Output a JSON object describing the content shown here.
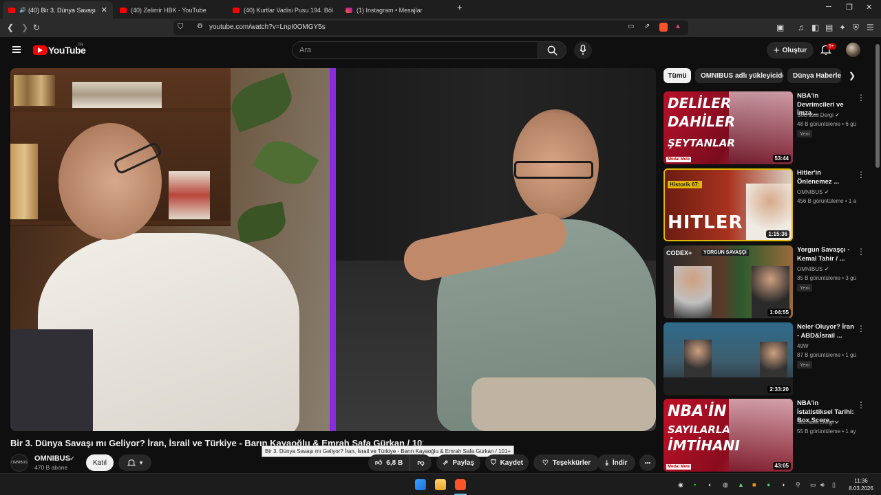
{
  "browser": {
    "tabs": [
      {
        "title": "(40) Bir 3. Dünya Savaşı mı Ge",
        "active": true,
        "icon": "youtube-icon"
      },
      {
        "title": "(40) Zelimir HBK - YouTube",
        "active": false,
        "icon": "youtube-icon"
      },
      {
        "title": "(40) Kurtlar Vadisi Pusu 194. Bölüm -",
        "active": false,
        "icon": "youtube-icon"
      },
      {
        "title": "(1) Instagram • Mesajlar",
        "active": false,
        "icon": "instagram-icon"
      }
    ],
    "new_tab": "+",
    "url": "youtube.com/watch?v=LnpI0OMGY5s",
    "window_controls": {
      "minimize": "─",
      "restore": "❐",
      "close": "✕"
    }
  },
  "header": {
    "logo_text": "YouTube",
    "logo_region": "TR",
    "search_placeholder": "Ara",
    "create_label": "Oluştur",
    "notification_count": "9+"
  },
  "video": {
    "title": "Bir 3. Dünya Savaşı mı Geliyor? İran, İsrail ve Türkiye - Barın Kayaoğlu & Emrah Safa Gürkan / 101+",
    "tooltip": "Bir 3. Dünya Savaşı mı Geliyor? İran, İsrail ve Türkiye - Barın Kayaoğlu & Emrah Safa Gürkan / 101+",
    "channel": {
      "name": "OMNIBUS",
      "subscribers": "470 B abone",
      "avatar_text": "OMNIBUS"
    },
    "join_label": "Katıl",
    "actions": {
      "likes": "6,8 B",
      "share": "Paylaş",
      "save": "Kaydet",
      "thanks": "Teşekkürler",
      "download": "İndir",
      "more": "•••"
    }
  },
  "chips": [
    {
      "label": "Tümü",
      "active": true
    },
    {
      "label": "OMNIBUS adlı yükleyiciden",
      "active": false
    },
    {
      "label": "Dünya Haberler",
      "active": false
    }
  ],
  "recommendations": [
    {
      "title": "NBA'in Devrimcileri ve İmza ...",
      "channel": "Socrates Dergi",
      "verified": true,
      "meta": "48 B görüntüleme • 6 gün önce",
      "badge": "Yeni",
      "duration": "53:44",
      "thumb_text": [
        "DELİLER",
        "DAHİLER",
        "ŞEYTANLAR"
      ],
      "thumb_brand": "Medal Mete"
    },
    {
      "title": "Hitler'in Önlenemez ...",
      "channel": "OMNIBUS",
      "verified": true,
      "meta": "456 B görüntüleme • 1 ay önce",
      "badge": "",
      "duration": "1:15:36",
      "thumb_text": [
        "Historik 67:",
        "HITLER"
      ],
      "thumb_brand": ""
    },
    {
      "title": "Yorgun Savaşçı - Kemal Tahir / ...",
      "channel": "OMNIBUS",
      "verified": true,
      "meta": "35 B görüntüleme • 3 gün önce",
      "badge": "Yeni",
      "duration": "1:04:55",
      "thumb_text": [
        "CODEX+",
        "YORGUN SAVAŞÇI"
      ],
      "thumb_brand": ""
    },
    {
      "title": "Neler Oluyor? İran - ABD&İsrail ...",
      "channel": "49W",
      "verified": false,
      "meta": "87 B görüntüleme • 1 gün önce",
      "badge": "Yeni",
      "duration": "2:33:20",
      "thumb_text": [],
      "thumb_brand": ""
    },
    {
      "title": "NBA'in İstatistiksel Tarihi: Box Score,...",
      "channel": "Socrates Dergi",
      "verified": true,
      "meta": "55 B görüntüleme • 1 ay önce",
      "badge": "",
      "duration": "43:05",
      "thumb_text": [
        "NBA'İN",
        "SAYILARLA",
        "İMTİHANI"
      ],
      "thumb_brand": "Medal Mete"
    }
  ],
  "taskbar": {
    "time": "11:36",
    "date": "8.03.2026"
  }
}
